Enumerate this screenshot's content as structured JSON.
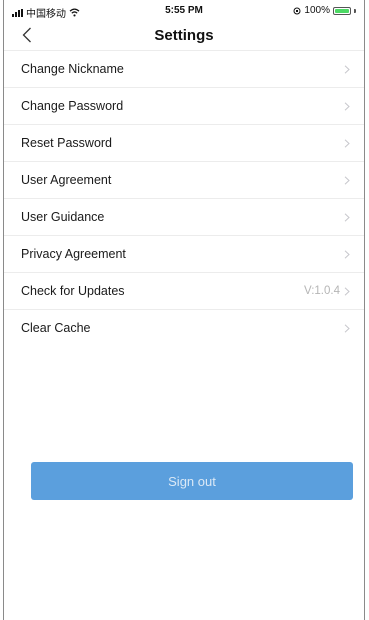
{
  "status_bar": {
    "carrier": "中国移动",
    "time": "5:55 PM",
    "battery_text": "100%",
    "battery_level": 1.0
  },
  "nav": {
    "title": "Settings"
  },
  "settings": {
    "items": [
      {
        "label": "Change Nickname",
        "value": ""
      },
      {
        "label": "Change Password",
        "value": ""
      },
      {
        "label": "Reset Password",
        "value": ""
      },
      {
        "label": "User Agreement",
        "value": ""
      },
      {
        "label": "User Guidance",
        "value": ""
      },
      {
        "label": "Privacy Agreement",
        "value": ""
      },
      {
        "label": "Check for Updates",
        "value": "V:1.0.4"
      },
      {
        "label": "Clear Cache",
        "value": ""
      }
    ]
  },
  "actions": {
    "sign_out_label": "Sign out"
  },
  "colors": {
    "accent": "#5b9fdd",
    "battery": "#4cd964",
    "chevron": "#c7c7cc"
  }
}
